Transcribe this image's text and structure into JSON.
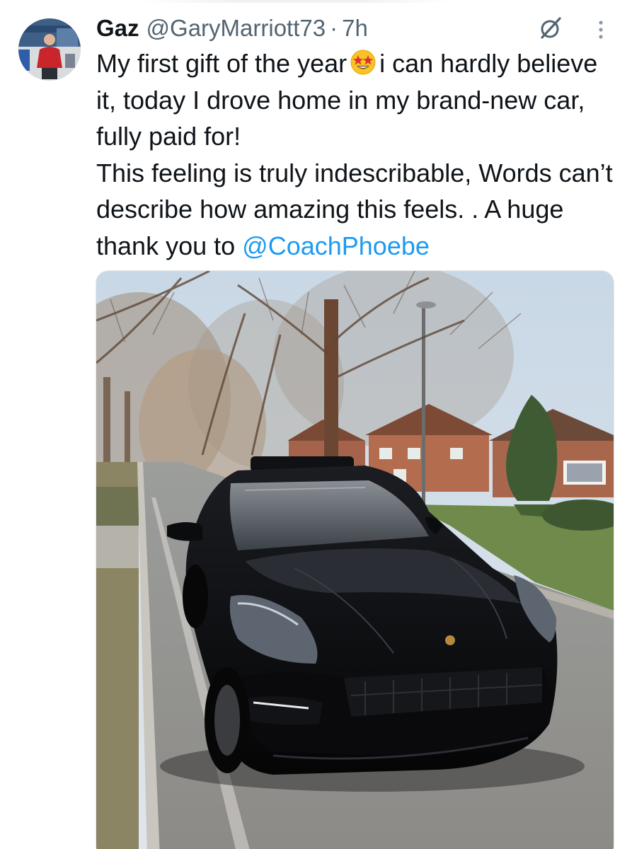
{
  "tweet": {
    "author_name": "Gaz",
    "author_handle": "@GaryMarriott73",
    "separator": "·",
    "time": "7h",
    "text_lines": {
      "p1_a": "My first gift of the year",
      "emoji": "star-struck-emoji",
      "p1_b": "i can hardly believe it, today I drove home in my brand-new car, fully paid for!",
      "p2_a": "This feeling is truly indescribable, Words can’t describe how amazing this feels. . A huge thank you to",
      "mention": "@CoachPhoebe"
    },
    "media_alt_icon": "photo",
    "icons": {
      "grok": "grok-icon",
      "more": "more-vertical-icon"
    }
  },
  "colors": {
    "text": "#0f1419",
    "secondary": "#536471",
    "link": "#1d9bf0"
  }
}
